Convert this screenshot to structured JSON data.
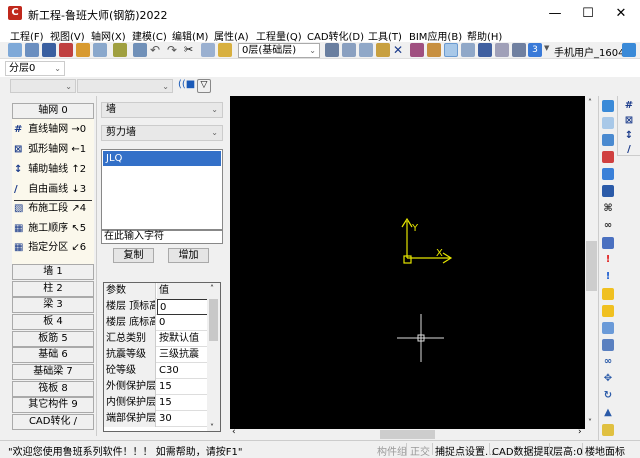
{
  "window": {
    "title": "新工程-鲁班大师(钢筋)2022",
    "logo": "C",
    "minimize": "—",
    "maximize": "☐",
    "close": "✕"
  },
  "menu": [
    "工程(F)",
    "视图(V)",
    "轴网(X)",
    "建模(C)",
    "编辑(M)",
    "属性(A)",
    "工程量(Q)",
    "CAD转化(D)",
    "工具(T)",
    "BIM应用(B)",
    "帮助(H)"
  ],
  "toolbar": {
    "floor_select": "0层(基础层)",
    "user": "手机用户_1604",
    "badge": "3"
  },
  "layer_select": "分层0",
  "left": {
    "header": "轴网 0",
    "tools": [
      {
        "icon": "#",
        "label": "直线轴网",
        "key": "→0"
      },
      {
        "icon": "⊠",
        "label": "弧形轴网",
        "key": "←1"
      },
      {
        "icon": "↕",
        "label": "辅助轴线",
        "key": "↑2"
      },
      {
        "icon": "/",
        "label": "自由画线",
        "key": "↓3"
      },
      {
        "icon": "▧",
        "label": "布施工段",
        "key": "↗4"
      },
      {
        "icon": "▦",
        "label": "施工顺序",
        "key": "↖5"
      },
      {
        "icon": "▦",
        "label": "指定分区",
        "key": "↙6"
      }
    ],
    "categories": [
      "墙 1",
      "柱 2",
      "梁 3",
      "板 4",
      "板筋 5",
      "基础 6",
      "基础梁 7",
      "筏板 8",
      "其它构件 9",
      "CAD转化 /"
    ]
  },
  "mid": {
    "type": "墙",
    "subtype": "剪力墙",
    "list": [
      "JLQ"
    ],
    "input_placeholder": "在此输入字符",
    "copy": "复制",
    "add": "增加",
    "props_header": [
      "参数",
      "值"
    ],
    "props": [
      [
        "楼层 顶标高",
        "0"
      ],
      [
        "楼层 底标高",
        "0"
      ],
      [
        "汇总类别",
        "按默认值"
      ],
      [
        "抗震等级",
        "三级抗震"
      ],
      [
        "砼等级",
        "C30"
      ],
      [
        "外侧保护层(",
        "15"
      ],
      [
        "内侧保护层(",
        "15"
      ],
      [
        "端部保护层(",
        "30"
      ]
    ]
  },
  "canvas": {
    "axis_x": "X",
    "axis_y": "Y",
    "axis_color": "#e6e600"
  },
  "status": {
    "message": "\"欢迎您使用鲁班系列软件！！！  如需帮助，请按F1\"",
    "items": [
      "构件组",
      "正交",
      "捕捉点设置...",
      "CAD数据提取",
      "层高:0",
      "楼地面标"
    ]
  }
}
